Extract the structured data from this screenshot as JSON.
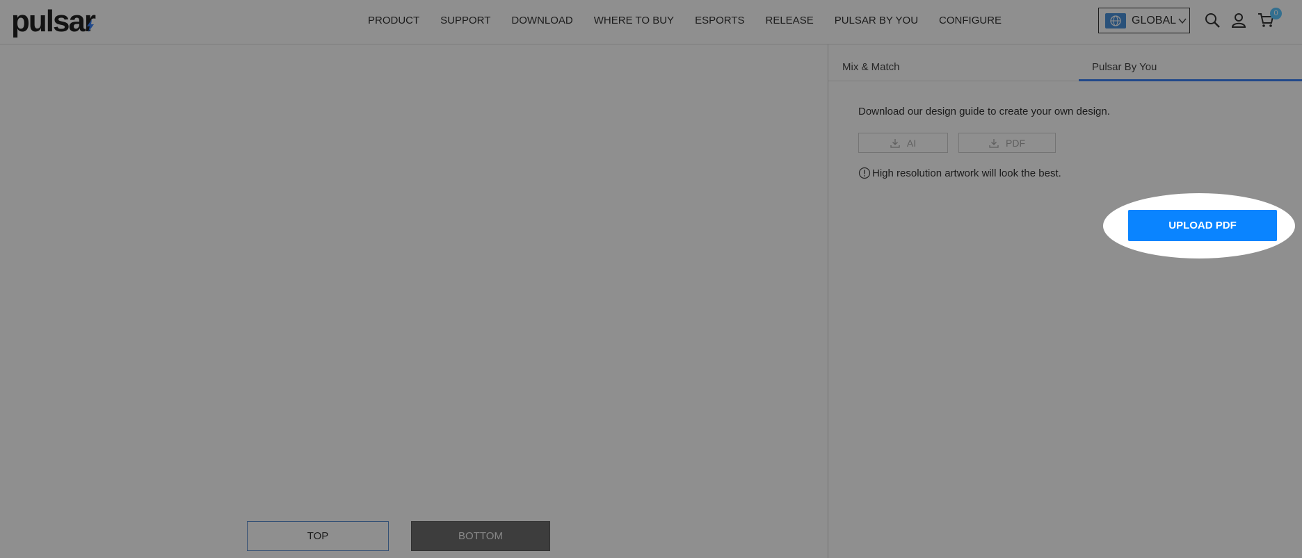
{
  "header": {
    "logo": "pulsar",
    "nav": [
      "PRODUCT",
      "SUPPORT",
      "DOWNLOAD",
      "WHERE TO BUY",
      "ESPORTS",
      "RELEASE",
      "PULSAR BY YOU",
      "CONFIGURE"
    ],
    "region": "GLOBAL",
    "cart_count": "0",
    "icons": {
      "region": "globe-icon",
      "dropdown": "chevron-down-icon",
      "search": "search-icon",
      "account": "user-icon",
      "cart": "cart-icon",
      "logo_mark": "lightning-bolt-icon"
    }
  },
  "canvas": {
    "views": [
      "TOP",
      "BOTTOM"
    ],
    "active_view": "BOTTOM"
  },
  "panel": {
    "tabs": [
      "Mix & Match",
      "Pulsar By You"
    ],
    "active_tab": "Pulsar By You",
    "guide_text": "Download our design guide to create your own design.",
    "downloads": [
      "AI",
      "PDF"
    ],
    "info_text": "High resolution artwork will look the best.",
    "upload_label": "UPLOAD PDF",
    "icons": {
      "download": "download-icon",
      "info": "info-icon"
    }
  },
  "colors": {
    "accent": "#0a84ff",
    "tab_underline": "#3b82f6",
    "cart_badge": "#5cc6ff",
    "overlay_dim": "rgba(0,0,0,0.44)"
  }
}
